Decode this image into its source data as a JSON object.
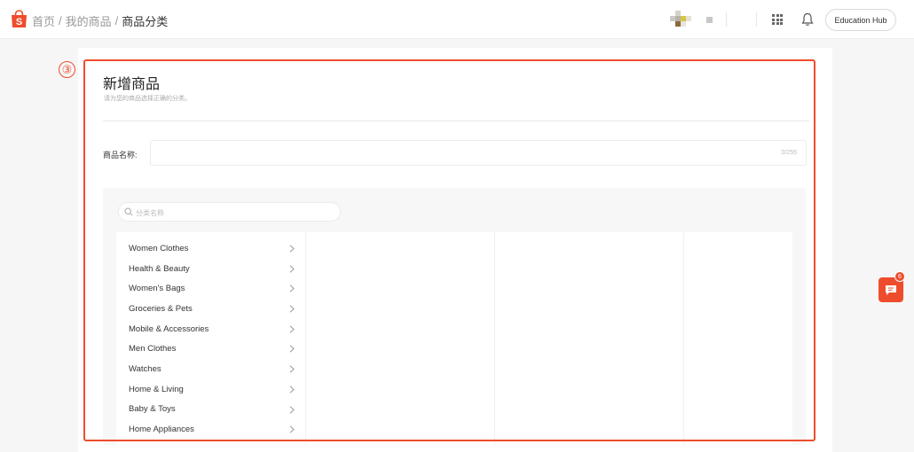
{
  "header": {
    "breadcrumb": [
      "首页",
      "我的商品",
      "商品分类"
    ],
    "separator": "/",
    "education_hub": "Education Hub",
    "brand_color": "#ee4d2d"
  },
  "step_marker": "③",
  "form": {
    "title": "新增商品",
    "subtitle": "请为您的商品选择正确的分类。",
    "name_label": "商品名称:",
    "name_value": "",
    "name_counter": "0/255"
  },
  "category": {
    "search_placeholder": "分类名称",
    "items": [
      "Women Clothes",
      "Health & Beauty",
      "Women's Bags",
      "Groceries & Pets",
      "Mobile & Accessories",
      "Men Clothes",
      "Watches",
      "Home & Living",
      "Baby & Toys",
      "Home Appliances"
    ]
  },
  "chat": {
    "badge": "6"
  },
  "icons": [
    "shopee-bag-icon",
    "apps-grid-icon",
    "bell-icon",
    "search-icon",
    "chevron-right-icon",
    "chat-icon"
  ]
}
